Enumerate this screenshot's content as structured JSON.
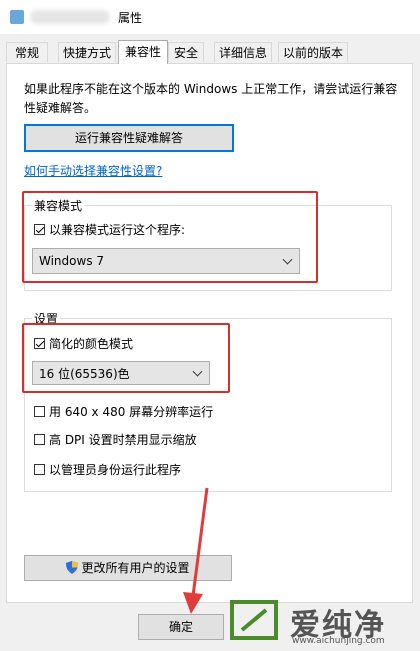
{
  "window": {
    "title": "属性"
  },
  "tabs": [
    "常规",
    "快捷方式",
    "兼容性",
    "安全",
    "详细信息",
    "以前的版本"
  ],
  "active_tab": "兼容性",
  "intro_text": "如果此程序不能在这个版本的 Windows 上正常工作，请尝试运行兼容性疑难解答。",
  "troubleshoot_button": "运行兼容性疑难解答",
  "manual_link": "如何手动选择兼容性设置?",
  "compat_mode": {
    "legend": "兼容模式",
    "checkbox_label": "以兼容模式运行这个程序:",
    "checked": true,
    "os_value": "Windows 7"
  },
  "settings": {
    "legend": "设置",
    "reduced_color": {
      "label": "简化的颜色模式",
      "checked": true
    },
    "color_value": "16 位(65536)色",
    "res640": {
      "label": "用 640 x 480 屏幕分辨率运行",
      "checked": false
    },
    "dpi": {
      "label": "高 DPI 设置时禁用显示缩放",
      "checked": false
    },
    "admin": {
      "label": "以管理员身份运行此程序",
      "checked": false
    }
  },
  "all_users_button": "更改所有用户的设置",
  "ok_button": "确定",
  "watermark": {
    "text": "爱纯净",
    "url": "www.aichunjing.com"
  },
  "colors": {
    "highlight": "#d32f2f",
    "accent": "#0078d7",
    "link": "#0066cc"
  }
}
